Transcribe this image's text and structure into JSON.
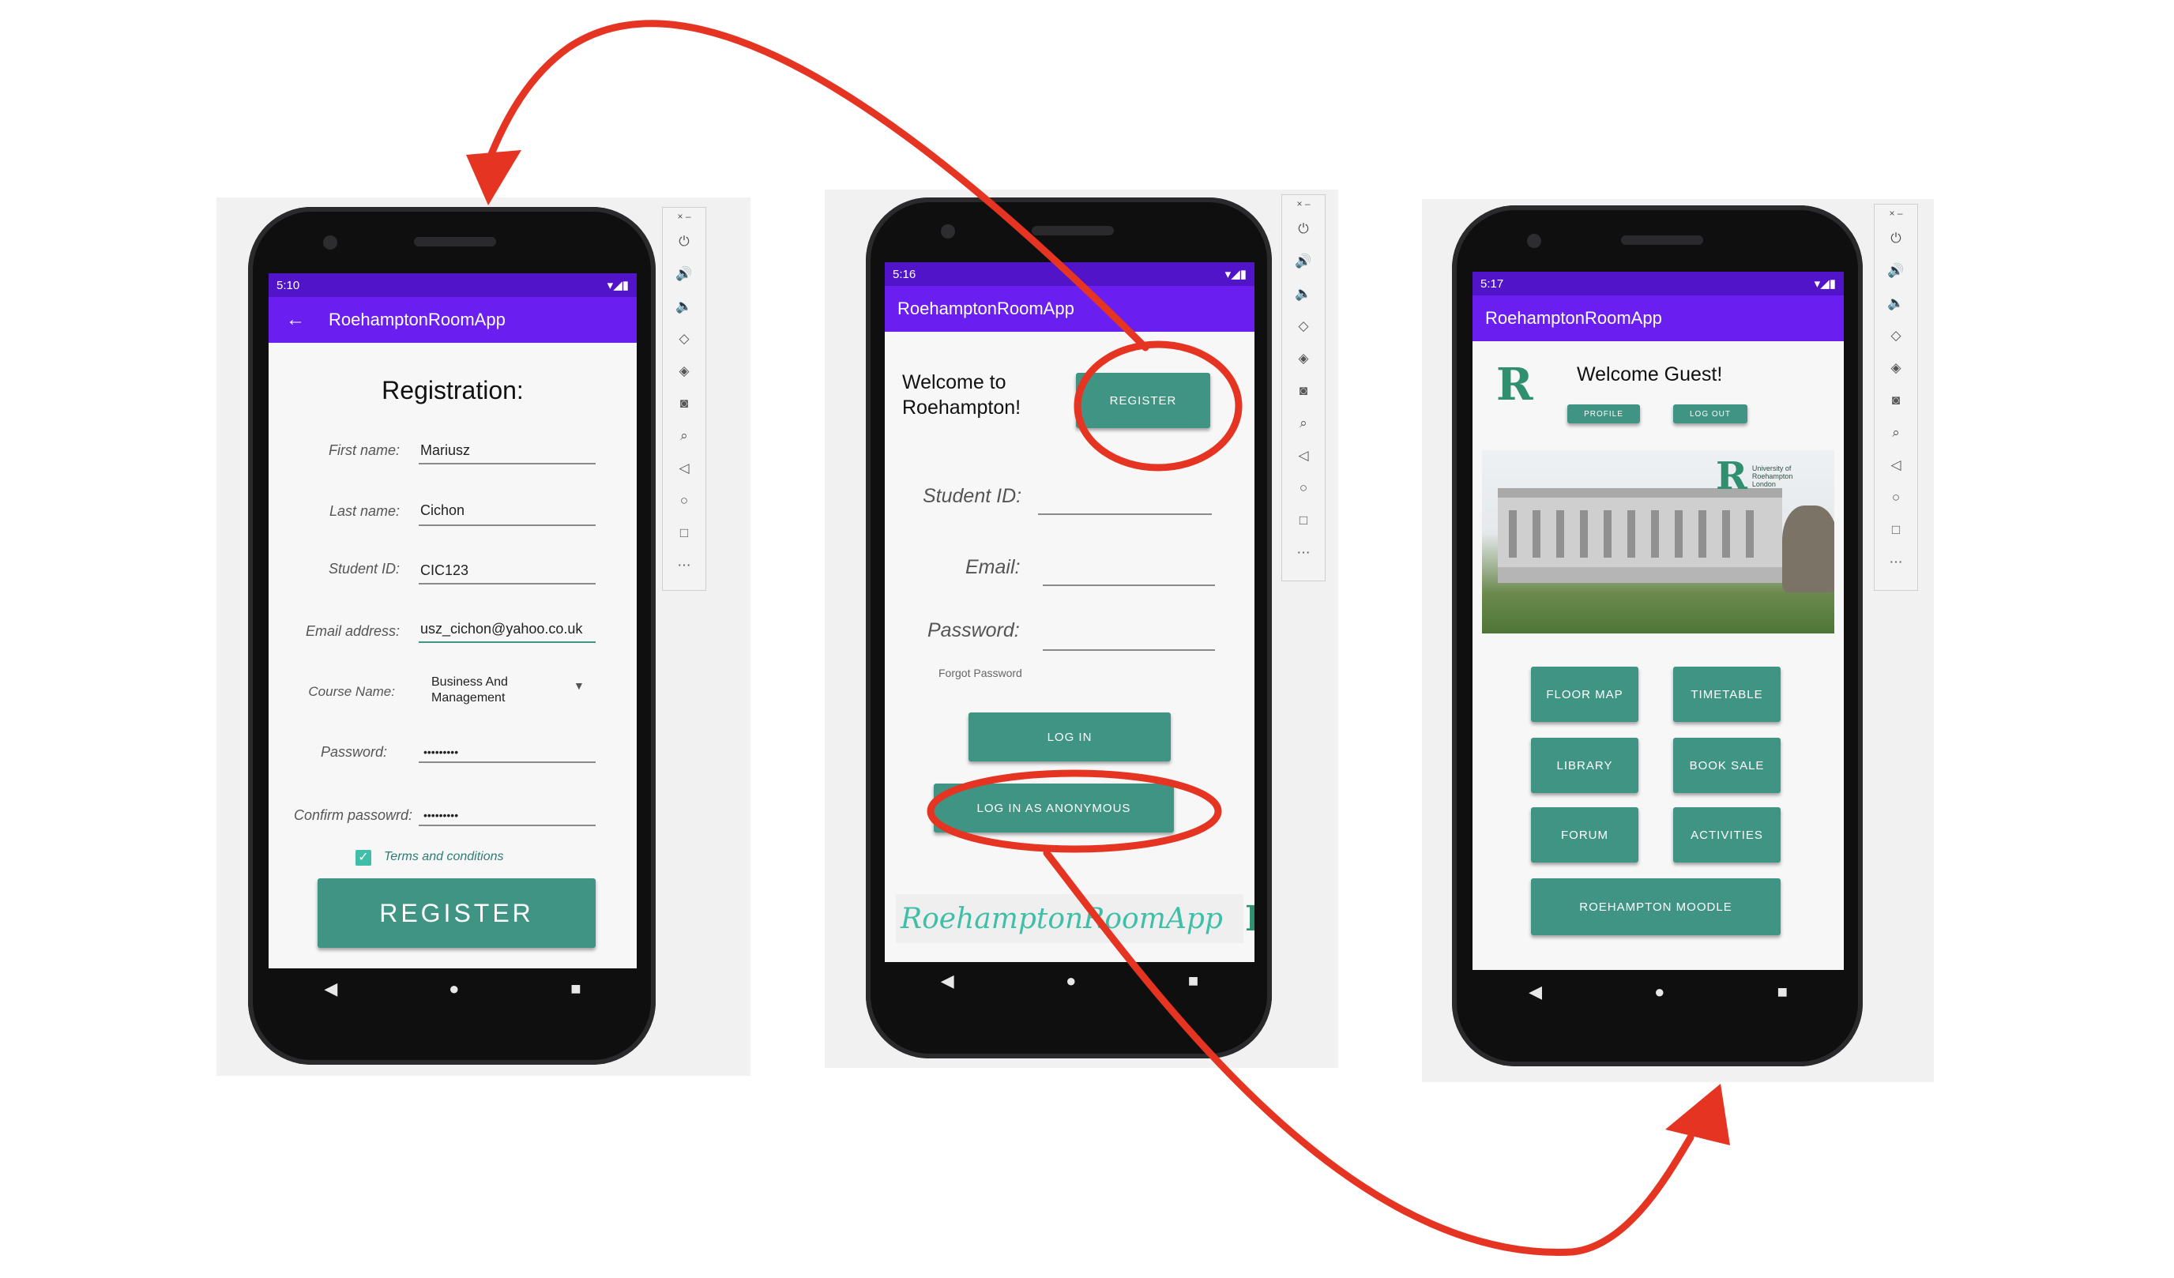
{
  "app_title": "RoehamptonRoomApp",
  "registration": {
    "status_time": "5:10",
    "heading": "Registration:",
    "fields": [
      {
        "label": "First name:",
        "value": "Mariusz"
      },
      {
        "label": "Last name:",
        "value": "Cichon"
      },
      {
        "label": "Student ID:",
        "value": "CIC123"
      },
      {
        "label": "Email address:",
        "value": "usz_cichon@yahoo.co.uk"
      },
      {
        "label": "Course Name:",
        "value": "Business And\nManagement"
      },
      {
        "label": "Password:",
        "value": "•••••••••"
      },
      {
        "label": "Confirm passowrd:",
        "value": "•••••••••"
      }
    ],
    "terms_label": "Terms and conditions",
    "register_label": "REGISTER"
  },
  "login": {
    "status_time": "5:16",
    "welcome": "Welcome to\nRoehampton!",
    "register_label": "REGISTER",
    "fields": [
      {
        "label": "Student ID:"
      },
      {
        "label": "Email:"
      },
      {
        "label": "Password:"
      }
    ],
    "forgot_password": "Forgot Password",
    "login_label": "LOG IN",
    "anonymous_label": "LOG IN AS ANONYMOUS",
    "footer_brand": "RoehamptonRoomApp"
  },
  "home": {
    "status_time": "5:17",
    "welcome": "Welcome Guest!",
    "profile_label": "PROFILE",
    "logout_label": "LOG OUT",
    "university_text": "University of\nRoehampton\nLondon",
    "buttons": [
      "FLOOR MAP",
      "TIMETABLE",
      "LIBRARY",
      "BOOK SALE",
      "FORUM",
      "ACTIVITIES"
    ],
    "moodle_label": "ROEHAMPTON MOODLE"
  },
  "colors": {
    "accent_teal": "#3f9483",
    "appbar_purple": "#6a1ff0",
    "annotation_red": "#e53422"
  }
}
